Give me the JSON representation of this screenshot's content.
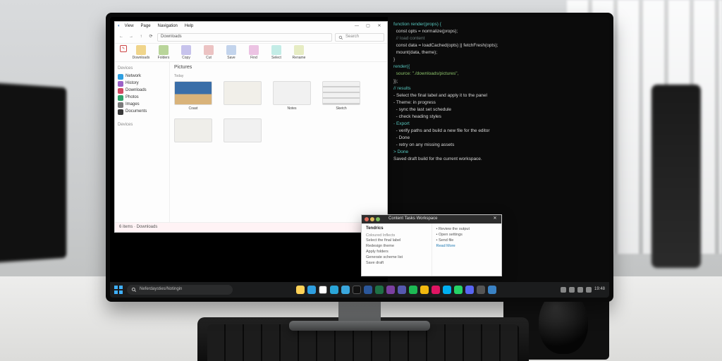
{
  "taskbar": {
    "search_placeholder": "Neferdaysties/Notingin",
    "time": "19:48",
    "icons": [
      {
        "name": "explorer-app",
        "color": "#ffd257"
      },
      {
        "name": "edge-app",
        "color": "#2f9fe0"
      },
      {
        "name": "store-app",
        "color": "#ffffff"
      },
      {
        "name": "mail-app",
        "color": "#2aa5d8"
      },
      {
        "name": "vscode-app",
        "color": "#3aa7dd"
      },
      {
        "name": "terminal-app",
        "color": "#111111"
      },
      {
        "name": "word-app",
        "color": "#2b579a"
      },
      {
        "name": "excel-app",
        "color": "#1e7145"
      },
      {
        "name": "onenote-app",
        "color": "#7b3fa0"
      },
      {
        "name": "teams-app",
        "color": "#5558af"
      },
      {
        "name": "spotify-app",
        "color": "#1db954"
      },
      {
        "name": "chrome-app",
        "color": "#f2b90f"
      },
      {
        "name": "slack-app",
        "color": "#e01563"
      },
      {
        "name": "skype-app",
        "color": "#00aff0"
      },
      {
        "name": "whatsapp-app",
        "color": "#25d366"
      },
      {
        "name": "discord-app",
        "color": "#5865f2"
      },
      {
        "name": "settings-app",
        "color": "#555555"
      },
      {
        "name": "notepad-app",
        "color": "#3a82c4"
      }
    ]
  },
  "explorer": {
    "title_tabs": [
      "View",
      "Page",
      "Navigation",
      "Help"
    ],
    "window_controls": {
      "minimize": "—",
      "maximize": "▢",
      "close": "✕"
    },
    "nav": {
      "back": "←",
      "forward": "→",
      "up": "↑",
      "refresh": "⟳"
    },
    "address": "Downloads",
    "search_placeholder": "Search",
    "ribbon_left_icon": "✎",
    "ribbon": [
      {
        "icon": "#f0d58b",
        "label": "Downloads"
      },
      {
        "icon": "#b9d59a",
        "label": "Folders"
      },
      {
        "icon": "#c7c3ec",
        "label": "Copy"
      },
      {
        "icon": "#ecc3c3",
        "label": "Cut"
      },
      {
        "icon": "#c3d4ec",
        "label": "Save"
      },
      {
        "icon": "#ecc3e3",
        "label": "Find"
      },
      {
        "icon": "#c3ece6",
        "label": "Select"
      },
      {
        "icon": "#e6ecc3",
        "label": "Rename"
      }
    ],
    "sidebar_header": "Devices",
    "sidebar": [
      {
        "color": "#2f9fe0",
        "label": "Network"
      },
      {
        "color": "#9c62c7",
        "label": "History"
      },
      {
        "color": "#d24a62",
        "label": "Downloads"
      },
      {
        "color": "#2fa36b",
        "label": "Photos"
      },
      {
        "color": "#7a7a7a",
        "label": "Images"
      },
      {
        "color": "#3a3a3a",
        "label": "Documents"
      }
    ],
    "sidebar_footer": "Devices",
    "content_header": "Pictures",
    "content_subhead": "Today",
    "thumbs": [
      {
        "label": "Coast",
        "bg": "linear-gradient(#3a6ea8 55%,#d9b37a 55%)"
      },
      {
        "label": "",
        "bg": "#f1efe9"
      },
      {
        "label": "Notes",
        "bg": "#f1f1f1"
      },
      {
        "label": "Sketch",
        "bg": "repeating-linear-gradient(0deg,#cfcfcf 0 2px,#f1f1f1 2px 8px)"
      },
      {
        "label": "",
        "bg": "#efeeea"
      },
      {
        "label": "",
        "bg": "#f1f1f1"
      }
    ],
    "status": "6 items  ·  Downloads"
  },
  "note": {
    "title": "Content Tasks Workspace",
    "close": "✕",
    "left_header": "Tendrics",
    "left_section": "Coloured Inflects",
    "left_items": [
      "Select the final label",
      "Redesign theme",
      "Apply folders",
      "Generate scheme list",
      "Save draft"
    ],
    "right_items": [
      "Review the output",
      "Open settings",
      "Send file"
    ],
    "right_link": "Read More"
  },
  "terminal": {
    "lines": [
      {
        "cls": "t-cy",
        "text": "function render(props) {"
      },
      {
        "cls": "t-wh",
        "text": "  const opts = normalize(props);"
      },
      {
        "cls": "t-cm",
        "text": "  // load content"
      },
      {
        "cls": "t-wh",
        "text": "  const data = loadCached(opts) || fetchFresh(opts);"
      },
      {
        "cls": "t-wh",
        "text": "  mount(data, theme);"
      },
      {
        "cls": "t-wh",
        "text": "}"
      },
      {
        "cls": "t-cy",
        "text": "render({"
      },
      {
        "cls": "t-gr",
        "text": "  source: \"./downloads/pictures\","
      },
      {
        "cls": "t-wh",
        "text": "});"
      },
      {
        "cls": "t-cy",
        "text": "// results"
      },
      {
        "cls": "t-wh",
        "text": "- Select the final label and apply it to the panel"
      },
      {
        "cls": "t-wh",
        "text": "- Theme: in progress"
      },
      {
        "cls": "t-wh",
        "text": "  - sync the last set schedule"
      },
      {
        "cls": "t-wh",
        "text": "  - check heading styles"
      },
      {
        "cls": "t-cy",
        "text": "- Export"
      },
      {
        "cls": "t-wh",
        "text": "  - verify paths and build a new file for the editor"
      },
      {
        "cls": "t-wh",
        "text": "  - Done"
      },
      {
        "cls": "t-wh",
        "text": "  - retry on any missing assets"
      },
      {
        "cls": "t-cy",
        "text": "> Done"
      },
      {
        "cls": "t-wh",
        "text": "Saved draft build for the current workspace."
      }
    ]
  }
}
